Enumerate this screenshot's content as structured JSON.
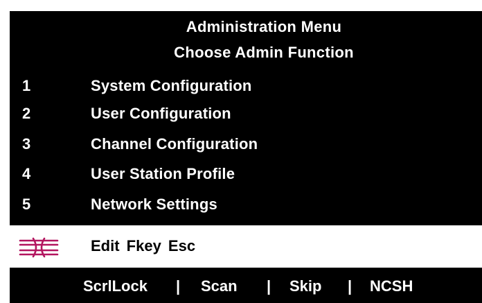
{
  "header": {
    "title": "Administration Menu",
    "subtitle": "Choose Admin Function"
  },
  "menu": {
    "items": [
      {
        "number": "1",
        "label": "System Configuration"
      },
      {
        "number": "2",
        "label": "User Configuration"
      },
      {
        "number": "3",
        "label": "Channel Configuration"
      },
      {
        "number": "4",
        "label": "User Station Profile"
      },
      {
        "number": "5",
        "label": "Network Settings"
      }
    ]
  },
  "command_bar": {
    "logo_icon": "brand-logo-icon",
    "text": "Edit Fkey Esc"
  },
  "footer": {
    "keys": [
      "ScrlLock",
      "Scan",
      "Skip",
      "NCSH"
    ],
    "separator": "|"
  },
  "colors": {
    "background": "#000000",
    "text": "#ffffff",
    "command_bar_bg": "#ffffff",
    "logo": "#b3155f"
  }
}
